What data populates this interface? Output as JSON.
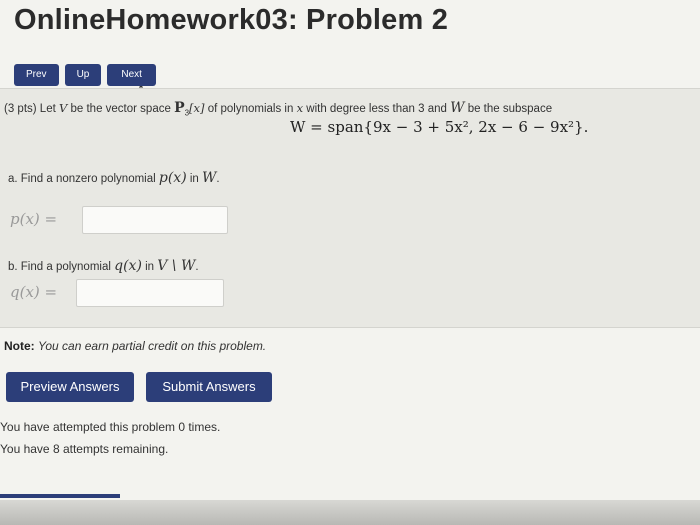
{
  "title": "OnlineHomework03: Problem 2",
  "nav": {
    "prev": "Prev",
    "up": "Up",
    "next": "Next"
  },
  "problem": {
    "points": "(3 pts)",
    "intro_pre": "Let ",
    "V": "V",
    "intro_mid": " be the vector space ",
    "space": "P",
    "space_sub": "3",
    "space_arg": "[x]",
    "intro_mid2": " of polynomials in ",
    "x": "x",
    "intro_post": " with degree less than 3 and ",
    "W": "W",
    "intro_end": " be the subspace",
    "span_eq": "W = span{9x − 3 + 5x², 2x − 6 − 9x²}."
  },
  "part_a": {
    "label_pre": "a. Find a nonzero polynomial ",
    "poly": "p(x)",
    "label_post": " in ",
    "space": "W",
    "label_end": ".",
    "lhs": "p(x) =",
    "value": ""
  },
  "part_b": {
    "label_pre": "b. Find a polynomial ",
    "poly": "q(x)",
    "label_post": " in ",
    "space": "V \\ W",
    "label_end": ".",
    "lhs": "q(x) =",
    "value": ""
  },
  "note": {
    "label": "Note:",
    "text": "You can earn partial credit on this problem."
  },
  "buttons": {
    "preview": "Preview Answers",
    "submit": "Submit Answers"
  },
  "status": {
    "attempted": "You have attempted this problem 0 times.",
    "remaining": "You have 8 attempts remaining."
  },
  "colors": {
    "button": "#2c3e79",
    "problem_bg": "#e8e8e3"
  }
}
